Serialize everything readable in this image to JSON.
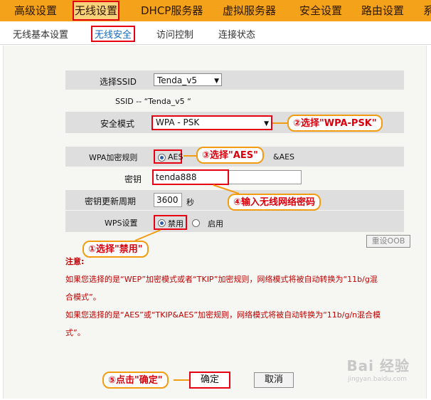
{
  "top_nav": {
    "tabs": [
      {
        "label": "高级设置"
      },
      {
        "label": "无线设置"
      },
      {
        "label": "DHCP服务器"
      },
      {
        "label": "虚拟服务器"
      },
      {
        "label": "安全设置"
      },
      {
        "label": "路由设置"
      },
      {
        "label": "系"
      }
    ],
    "active_index": 1
  },
  "sub_nav": {
    "tabs": [
      {
        "label": "无线基本设置"
      },
      {
        "label": "无线安全"
      },
      {
        "label": "访问控制"
      },
      {
        "label": "连接状态"
      }
    ],
    "active_index": 1
  },
  "form": {
    "ssid_label": "选择SSID",
    "ssid_value": "Tenda_v5",
    "ssid_info": "SSID -- “Tenda_v5 “",
    "security_mode_label": "安全模式",
    "security_mode_value": "WPA - PSK",
    "cipher_label": "WPA加密规则",
    "cipher_options": [
      "AES",
      "TKIP&AES"
    ],
    "cipher_option_visible_tail": "&AES",
    "cipher_selected": "AES",
    "key_label": "密钥",
    "key_value": "tenda888",
    "rekey_label": "密钥更新周期",
    "rekey_value": "3600",
    "rekey_unit": "秒",
    "wps_label": "WPS设置",
    "wps_options": [
      "禁用",
      "启用"
    ],
    "wps_selected": "禁用",
    "reset_oob_label": "重设OOB"
  },
  "notes": {
    "title": "注意:",
    "line1": "如果您选择的是“WEP”加密模式或者“TKIP”加密规则，网络模式将被自动转换为“11b/g混",
    "line1b": "合模式”。",
    "line2": "如果您选择的是“AES”或“TKIP&AES”加密规则，网络模式将被自动转换为“11b/g/n混合模",
    "line2b": "式”。"
  },
  "buttons": {
    "ok": "确定",
    "cancel": "取消"
  },
  "callouts": {
    "c1": "①选择\"禁用\"",
    "c2": "②选择\"WPA-PSK\"",
    "c3": "③选择\"AES\"",
    "c4": "④输入无线网络密码",
    "c5": "⑤点击\"确定\""
  },
  "watermark": {
    "text": "Bai 经验",
    "sub": "jingyan.baidu.com"
  },
  "colors": {
    "nav_orange": "#f3a21a",
    "highlight_red": "#e60012",
    "callout_border": "#f39c12",
    "note_red": "#c00000"
  }
}
